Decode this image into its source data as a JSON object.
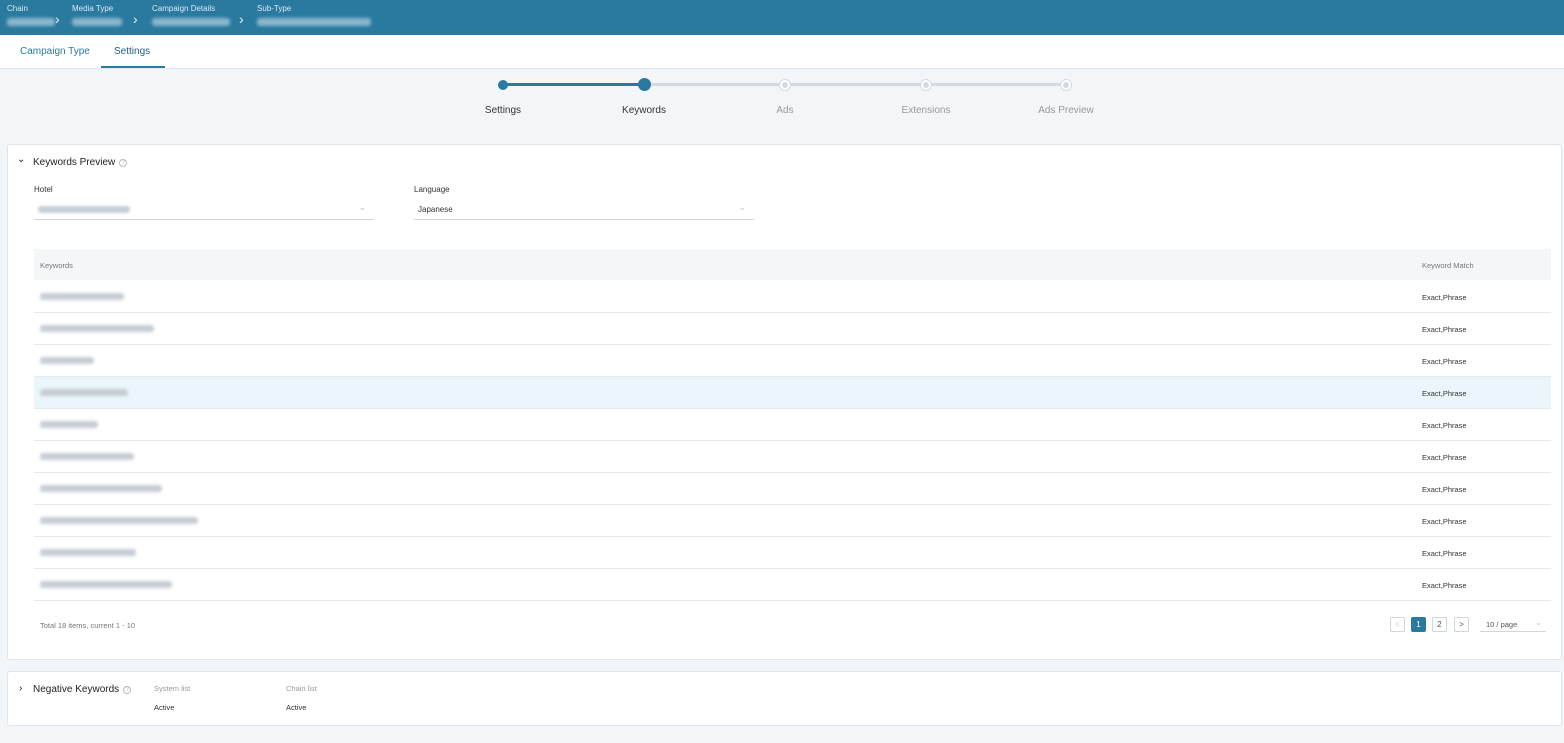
{
  "header": {
    "breadcrumbs": [
      {
        "label": "Chain"
      },
      {
        "label": "Media Type"
      },
      {
        "label": "Campaign Details"
      },
      {
        "label": "Sub-Type"
      }
    ]
  },
  "tabs": [
    {
      "label": "Campaign Type"
    },
    {
      "label": "Settings"
    }
  ],
  "stepper": {
    "steps": [
      {
        "label": "Settings",
        "state": "done"
      },
      {
        "label": "Keywords",
        "state": "current"
      },
      {
        "label": "Ads",
        "state": "todo"
      },
      {
        "label": "Extensions",
        "state": "todo"
      },
      {
        "label": "Ads Preview",
        "state": "todo"
      }
    ]
  },
  "keywords_preview": {
    "title": "Keywords Preview",
    "hotel_label": "Hotel",
    "language_label": "Language",
    "language_value": "Japanese",
    "columns": {
      "keywords": "Keywords",
      "match": "Keyword Match"
    },
    "rows": [
      {
        "match": "Exact,Phrase"
      },
      {
        "match": "Exact,Phrase"
      },
      {
        "match": "Exact,Phrase"
      },
      {
        "match": "Exact,Phrase"
      },
      {
        "match": "Exact,Phrase"
      },
      {
        "match": "Exact,Phrase"
      },
      {
        "match": "Exact,Phrase"
      },
      {
        "match": "Exact,Phrase"
      },
      {
        "match": "Exact,Phrase"
      },
      {
        "match": "Exact,Phrase"
      }
    ],
    "total_text": "Total 18 items, current 1 - 10",
    "pagination": {
      "prev": "<",
      "pages": [
        "1",
        "2"
      ],
      "next": ">",
      "page_size": "10 / page"
    }
  },
  "negative_keywords": {
    "title": "Negative Keywords",
    "system_list_label": "System list",
    "system_list_value": "Active",
    "chain_list_label": "Chain list",
    "chain_list_value": "Active"
  },
  "colors": {
    "accent": "#2a7aa0",
    "step_todo": "#d4dbe0",
    "row_highlight": "#eaf6fb"
  }
}
